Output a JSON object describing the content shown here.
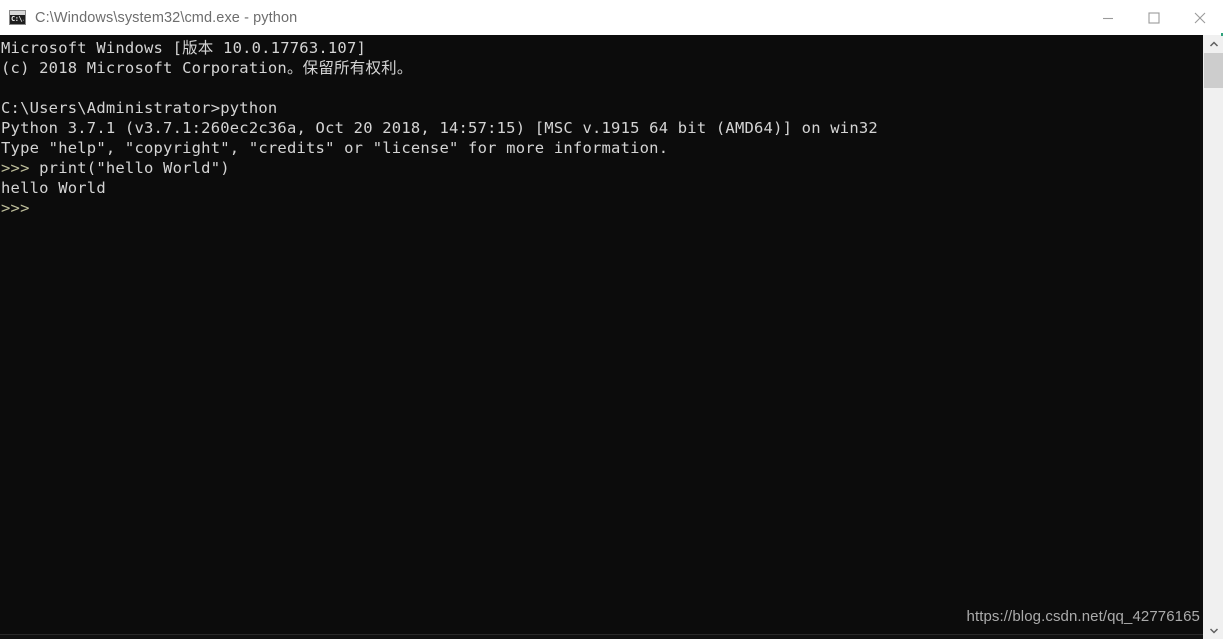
{
  "window": {
    "title": "C:\\Windows\\system32\\cmd.exe - python",
    "icon": "cmd-console-icon",
    "icon_glyph": "C:\\.",
    "background_color": "#0c0c0c",
    "titlebar_color": "#ffffff"
  },
  "window_controls": {
    "minimize_label": "Minimize",
    "maximize_label": "Maximize",
    "close_label": "Close"
  },
  "console": {
    "lines": [
      "Microsoft Windows [版本 10.0.17763.107]",
      "(c) 2018 Microsoft Corporation。保留所有权利。",
      "",
      "C:\\Users\\Administrator>python",
      "Python 3.7.1 (v3.7.1:260ec2c36a, Oct 20 2018, 14:57:15) [MSC v.1915 64 bit (AMD64)] on win32",
      "Type \"help\", \"copyright\", \"credits\" or \"license\" for more information.",
      ">>> print(\"hello World\")",
      "hello World",
      ">>>"
    ],
    "full_text": "Microsoft Windows [版本 10.0.17763.107]\n(c) 2018 Microsoft Corporation。保留所有权利。\n\nC:\\Users\\Administrator>python\nPython 3.7.1 (v3.7.1:260ec2c36a, Oct 20 2018, 14:57:15) [MSC v.1915 64 bit (AMD64)] on win32\nType \"help\", \"copyright\", \"credits\" or \"license\" for more information.\n>>> print(\"hello World\")\nhello World\n>>>",
    "text_color": "#d4d4d4",
    "prompt_symbol": ">>>",
    "command_entered": "print(\"hello World\")",
    "command_output": "hello World",
    "python_version": "3.7.1",
    "windows_version": "10.0.17763.107"
  },
  "watermark": {
    "text": "https://blog.csdn.net/qq_42776165"
  },
  "scrollbar": {
    "up_arrow": "chevron-up-icon",
    "down_arrow": "chevron-down-icon",
    "thumb_position_percent": 0,
    "track_color": "#f0f0f0",
    "thumb_color": "#cdcdcd"
  }
}
